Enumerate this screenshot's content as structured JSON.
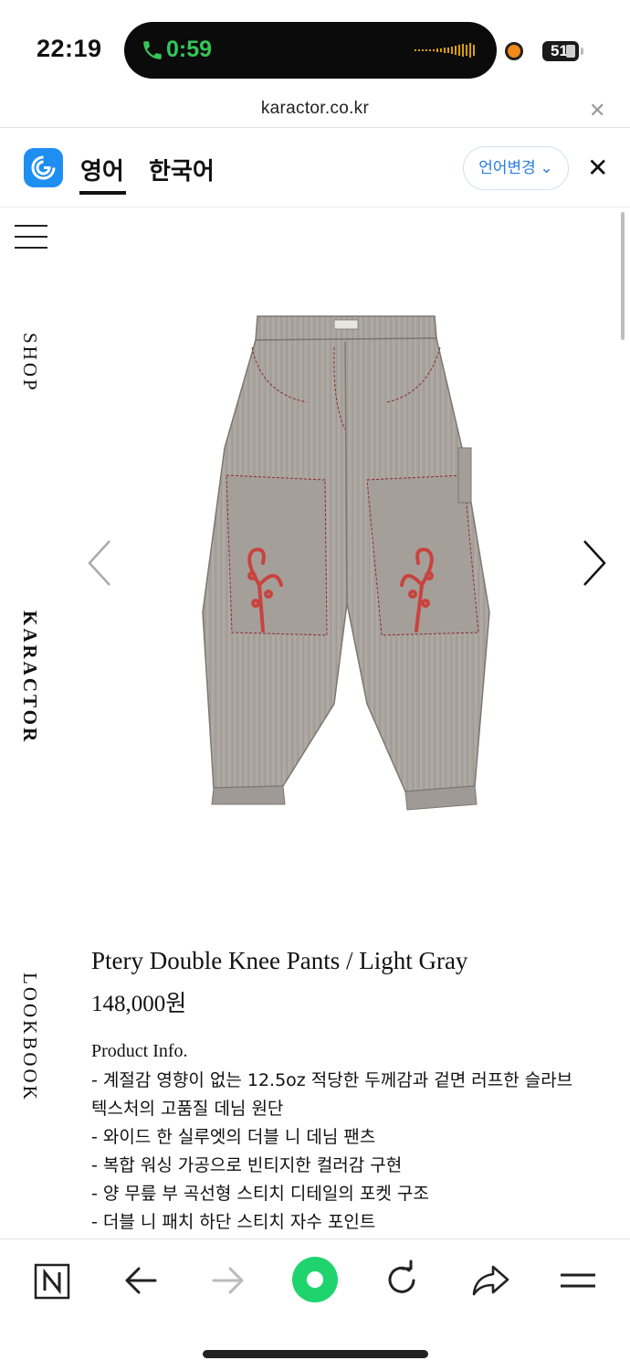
{
  "status_bar": {
    "time": "22:19",
    "call_timer": "0:59",
    "battery": "51",
    "colors": {
      "call_green": "#34c759",
      "recording_orange": "#f08a18"
    }
  },
  "browser": {
    "url": "karactor.co.kr"
  },
  "translate_bar": {
    "tab_source": "영어",
    "tab_target": "한국어",
    "change_language": "언어변경",
    "accent": "#2a7de1"
  },
  "side_nav": {
    "items": [
      "SHOP",
      "KARACTOR",
      "LOOKBOOK"
    ]
  },
  "product": {
    "name": "Ptery Double Knee Pants / Light Gray",
    "price": "148,000원",
    "info_heading": "Product Info.",
    "info_lines": [
      "- 계절감 영향이 없는 12.5oz 적당한 두께감과 겉면 러프한 슬라브",
      "텍스처의 고품질 데님 원단",
      "- 와이드 한 실루엣의 더블 니 데님 팬츠",
      "- 복합 워싱 가공으로 빈티지한 컬러감 구현",
      "- 양 무릎 부 곡선형 스티치 디테일의 포켓 구조",
      "- 더블 니 패치 하단 스티치 자수 포인트"
    ]
  },
  "toolbar": {
    "icons": [
      "naver-n-icon",
      "back-arrow-icon",
      "forward-arrow-icon",
      "green-circle-icon",
      "reload-icon",
      "share-icon",
      "menu-icon"
    ],
    "green": "#1fd36d"
  }
}
